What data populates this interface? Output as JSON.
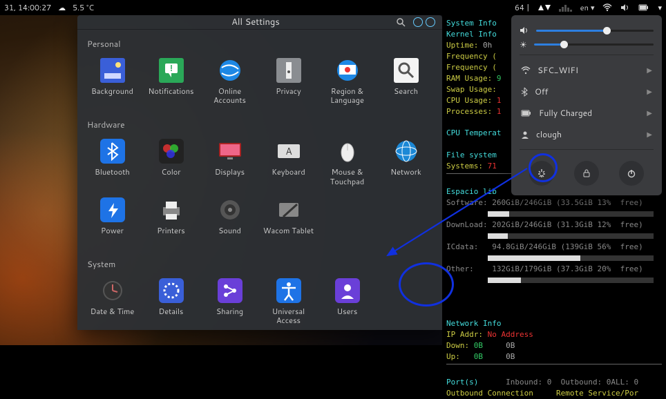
{
  "topbar": {
    "datetime": "31, 14:00:27",
    "temp": "5.5 °C",
    "right_text": "64 |",
    "lang": "en",
    "downarrow": "▾"
  },
  "settings": {
    "title": "All Settings",
    "sections": {
      "personal": {
        "label": "Personal",
        "items": [
          {
            "name": "background",
            "label": "Background",
            "color": "#3a5fd8"
          },
          {
            "name": "notifications",
            "label": "Notifications",
            "color": "#2aa858"
          },
          {
            "name": "online-accounts",
            "label": "Online Accounts",
            "color": "#1e88e5"
          },
          {
            "name": "privacy",
            "label": "Privacy",
            "color": "#8a8d91"
          },
          {
            "name": "region-language",
            "label": "Region & Language",
            "color": "#1e88e5"
          },
          {
            "name": "search",
            "label": "Search",
            "color": "#f4f4f4"
          }
        ]
      },
      "hardware": {
        "label": "Hardware",
        "items": [
          {
            "name": "bluetooth",
            "label": "Bluetooth",
            "color": "#1e73e6"
          },
          {
            "name": "color",
            "label": "Color",
            "color": "#222"
          },
          {
            "name": "displays",
            "label": "Displays",
            "color": "#a22"
          },
          {
            "name": "keyboard",
            "label": "Keyboard",
            "color": "#ddd"
          },
          {
            "name": "mouse-touchpad",
            "label": "Mouse & Touchpad",
            "color": "#eee"
          },
          {
            "name": "network",
            "label": "Network",
            "color": "#1b88d6"
          },
          {
            "name": "power",
            "label": "Power",
            "color": "#1e73e6"
          },
          {
            "name": "printers",
            "label": "Printers",
            "color": "#eee"
          },
          {
            "name": "sound",
            "label": "Sound",
            "color": "#555"
          },
          {
            "name": "wacom",
            "label": "Wacom Tablet",
            "color": "#888"
          }
        ]
      },
      "system": {
        "label": "System",
        "items": [
          {
            "name": "date-time",
            "label": "Date & Time",
            "color": "#555"
          },
          {
            "name": "details",
            "label": "Details",
            "color": "#3a5fd8"
          },
          {
            "name": "sharing",
            "label": "Sharing",
            "color": "#6a3fd8"
          },
          {
            "name": "universal-access",
            "label": "Universal Access",
            "color": "#1e73e6"
          },
          {
            "name": "users",
            "label": "Users",
            "color": "#6a3fd8"
          }
        ]
      }
    }
  },
  "terminal": {
    "sysinfo_hdr": "System Info",
    "kernel": "Kernel Info",
    "uptime": "Uptime: ",
    "uptime_v": "0h",
    "freq1": "Frequency (",
    "freq2": "Frequency (",
    "ram": "RAM Usage: ",
    "swap": "Swap Usage:",
    "cpu": "CPU Usage: ",
    "procs": "Processes: ",
    "cputemp": "CPU Temperat",
    "fs_hdr": "File system",
    "systems": "Systems:",
    "systems_v": "71",
    "espacio": "Espacio lib",
    "rows": [
      {
        "name": "Software:",
        "val": "260GiB/246GiB (33.5GiB 13%",
        "bar": 13,
        "tail": "free)"
      },
      {
        "name": "DownLoad:",
        "val": "202GiB/246GiB (31.3GiB 12%",
        "bar": 12,
        "tail": "free)"
      },
      {
        "name": "ICdata:",
        "val": "94.8GiB/246GiB (139GiB 56%",
        "bar": 56,
        "tail": "free)"
      },
      {
        "name": "Other:",
        "val": "132GiB/179GiB (37.3GiB 20%",
        "bar": 20,
        "tail": "free)"
      }
    ],
    "net_hdr": "Network Info",
    "ip": "IP Addr: ",
    "ip_v": "No Address",
    "down": "Down: ",
    "down_v": "0B",
    "down_t": "0B",
    "up": "Up:   ",
    "up_v": "0B",
    "up_t": "0B",
    "ports": "Port(s)",
    "inbound": "Inbound: 0  Outbound: 0ALL: 0",
    "outconn": "Outbound Connection",
    "remote": "Remote Service/Por"
  },
  "sysmenu": {
    "volume_pct": 60,
    "brightness_pct": 25,
    "items": [
      {
        "icon": "wifi",
        "label": "SFC_WIFI"
      },
      {
        "icon": "bt",
        "label": "Off"
      },
      {
        "icon": "bat",
        "label": "Fully Charged"
      },
      {
        "icon": "user",
        "label": "clough"
      }
    ]
  }
}
